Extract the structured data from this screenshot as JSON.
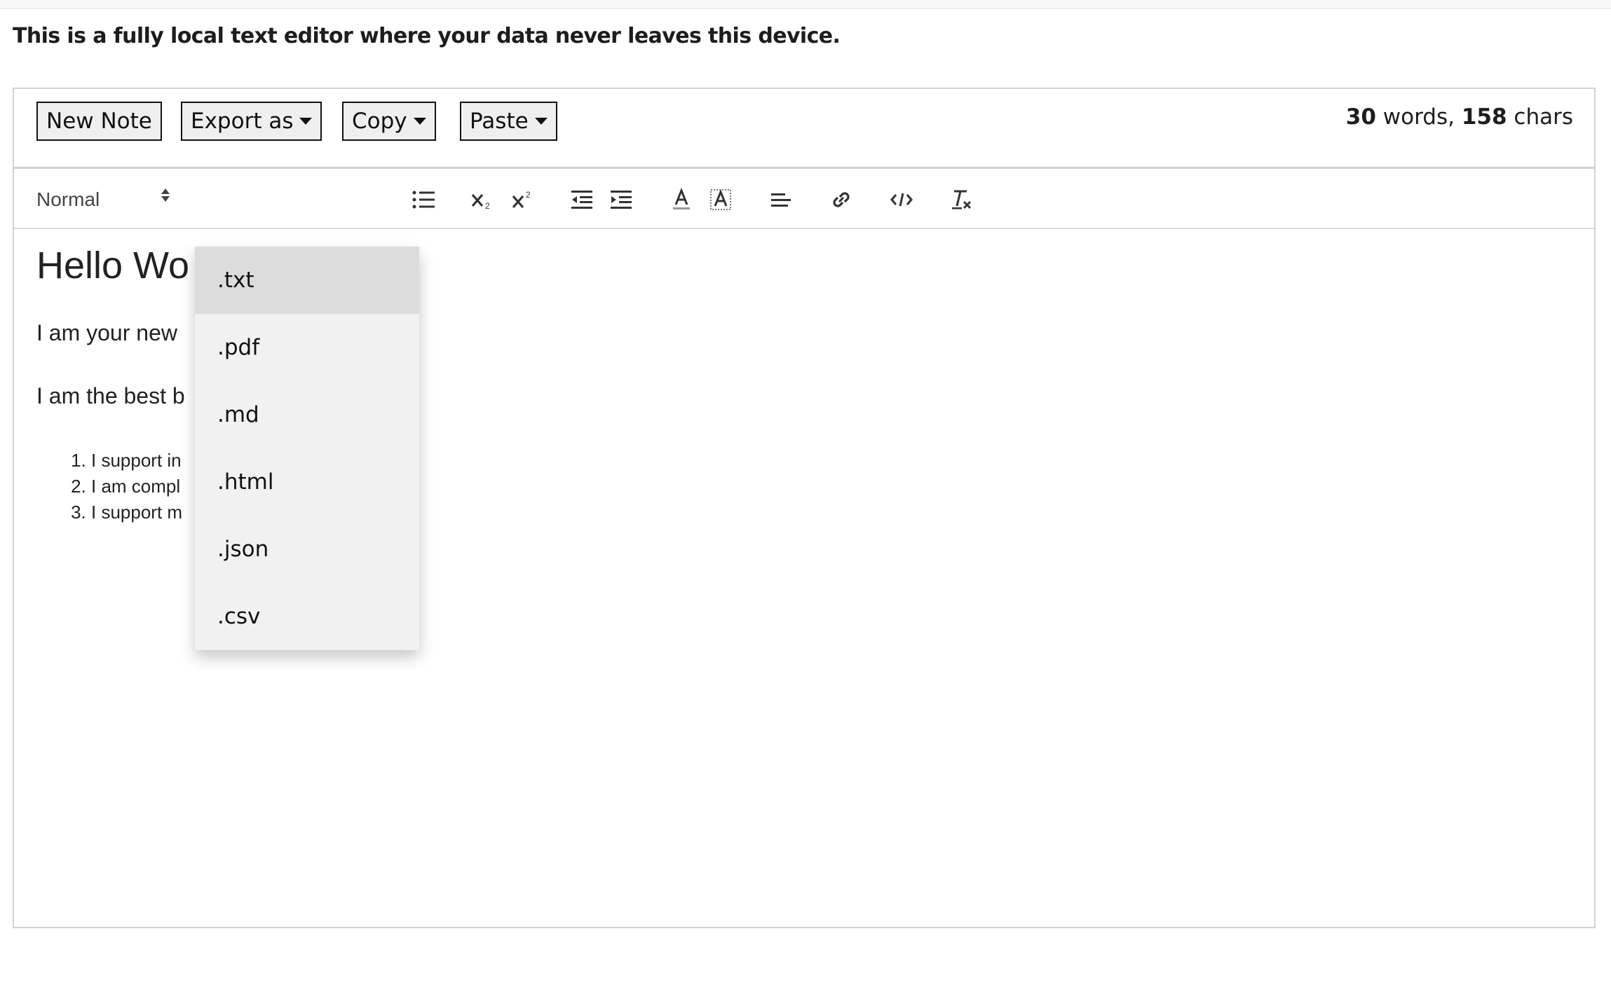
{
  "tagline": "This is a fully local text editor where your data never leaves this device.",
  "toolbar": {
    "new_note": "New Note",
    "export_as": "Export as",
    "copy": "Copy",
    "paste": "Paste"
  },
  "counter": {
    "words": "30",
    "words_label": " words, ",
    "chars": "158",
    "chars_label": " chars"
  },
  "format_bar": {
    "block_style": "Normal",
    "icons": [
      "bullet-list-icon",
      "subscript-icon",
      "superscript-icon",
      "outdent-icon",
      "indent-icon",
      "text-color-icon",
      "background-color-icon",
      "align-left-icon",
      "link-icon",
      "code-icon",
      "clear-format-icon"
    ]
  },
  "content": {
    "heading": "Hello Wo",
    "para1": "I am your new",
    "para2": "I am the best b",
    "list": [
      "I support in",
      "I am compl",
      "I support m"
    ]
  },
  "export_menu": {
    "options": [
      ".txt",
      ".pdf",
      ".md",
      ".html",
      ".json",
      ".csv"
    ],
    "highlighted": ".txt"
  },
  "colors": {
    "frame_border": "#d2d2d2",
    "button_bg": "#efefef",
    "menu_bg": "#f1f1f1",
    "menu_highlight": "#dcdcdc"
  }
}
